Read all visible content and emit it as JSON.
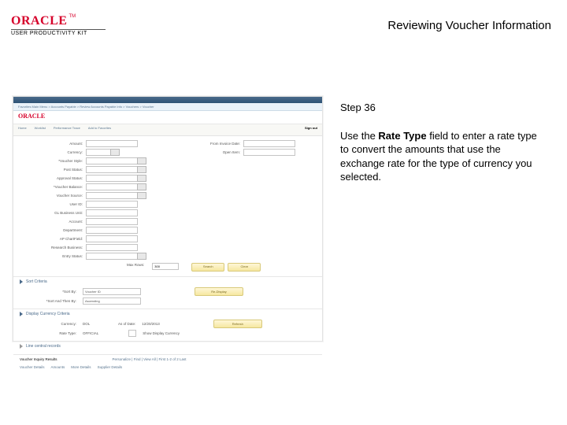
{
  "header": {
    "logo_brand": "ORACLE",
    "logo_tm": "TM",
    "logo_sub": "USER PRODUCTIVITY KIT",
    "title": "Reviewing Voucher Information"
  },
  "panel": {
    "step": "Step 36",
    "instr_pre": "Use the ",
    "instr_bold": "Rate Type",
    "instr_post": " field to enter a rate type to convert the amounts that use the exchange rate for the type of currency you selected."
  },
  "shot": {
    "crumb": "Favorites   Main Menu > Accounts Payable > Review Accounts Payable Info > Vouchers > Voucher",
    "brand": "ORACLE",
    "tabs": [
      "Home",
      "Worklist",
      "Performance Trace",
      "Add to Favorites",
      "Sign out"
    ],
    "fields": {
      "amount": "Amount:",
      "currency": "Currency:",
      "voucher_style": "*Voucher Style:",
      "post_status": "Post Status:",
      "approval_status": "Approval Status:",
      "voucher_balance": "*Voucher Balance:",
      "voucher_source": "Voucher Source:",
      "user_id": "User ID:",
      "gl_business_unit": "GL Business Unit:",
      "account": "Account:",
      "department": "Department:",
      "ap_chartfield": "AP ChartField:",
      "research_business": "Research Business:",
      "entry_status": "Entry Status:"
    },
    "fields2": {
      "from_invoice_date": "From Invoice Date:",
      "open_item": "Open Item:"
    },
    "max_rows_label": "Max Rows:",
    "max_rows_value": "300",
    "buttons": {
      "search": "Search",
      "clear": "Clear"
    },
    "sections": {
      "sort": "Sort Criteria",
      "display": "Display Currency Criteria",
      "records": "Line central records"
    },
    "sort": {
      "sort_by": "*Sort By:",
      "sort_by_val": "Voucher ID",
      "sort_then_by": "*Sort And Then By:",
      "sort_then_val": "Ascending",
      "redisplay_btn": "Re-Display"
    },
    "display": {
      "currency": "Currency:",
      "currency_val": "DOL",
      "rate_type": "Rate Type:",
      "rate_type_val": "OFFICIAL",
      "as_of_date": "As of Date:",
      "as_of_date_val": "12/20/2013",
      "checkbox": "Show Display Currency",
      "refresh_btn": "Refresh"
    },
    "results": {
      "title": "Voucher Inquiry Results",
      "pager": "Personalize | Find | View All |     First   1-2 of 2   Last"
    },
    "result_tabs": [
      "Voucher Details",
      "Amounts",
      "More Details",
      "Supplier Details"
    ]
  }
}
